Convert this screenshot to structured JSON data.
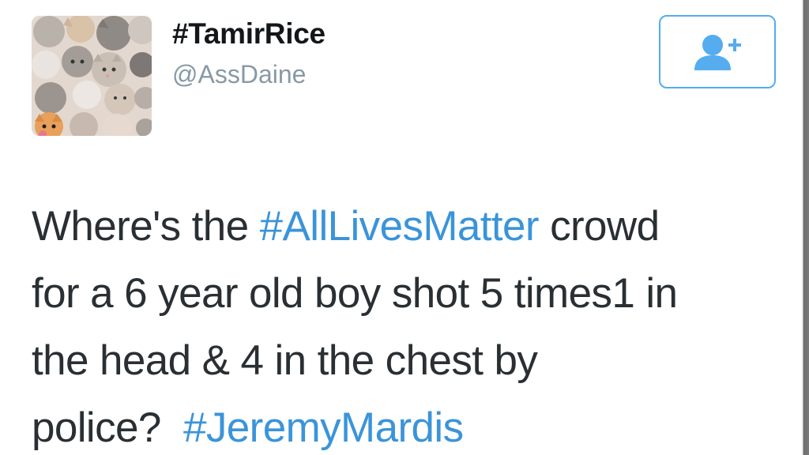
{
  "user": {
    "display_name": "#TamirRice",
    "handle": "@AssDaine",
    "avatar_icon": "cat-collage-avatar"
  },
  "follow_button": {
    "icon": "follow-user-plus-icon",
    "color": "#55acee"
  },
  "tweet": {
    "segments": [
      {
        "type": "text",
        "value": "Where's the "
      },
      {
        "type": "hashtag",
        "value": "#AllLivesMatter"
      },
      {
        "type": "text",
        "value": " crowd"
      },
      {
        "type": "text",
        "value": "for a 6 year old boy shot 5 times1 in"
      },
      {
        "type": "text",
        "value": "the head & 4 in the chest by"
      },
      {
        "type": "text",
        "value": "police?  "
      },
      {
        "type": "hashtag",
        "value": "#JeremyMardis"
      }
    ]
  },
  "colors": {
    "hashtag": "#3b94d9",
    "text": "#292f33",
    "handle": "#8899a6"
  }
}
